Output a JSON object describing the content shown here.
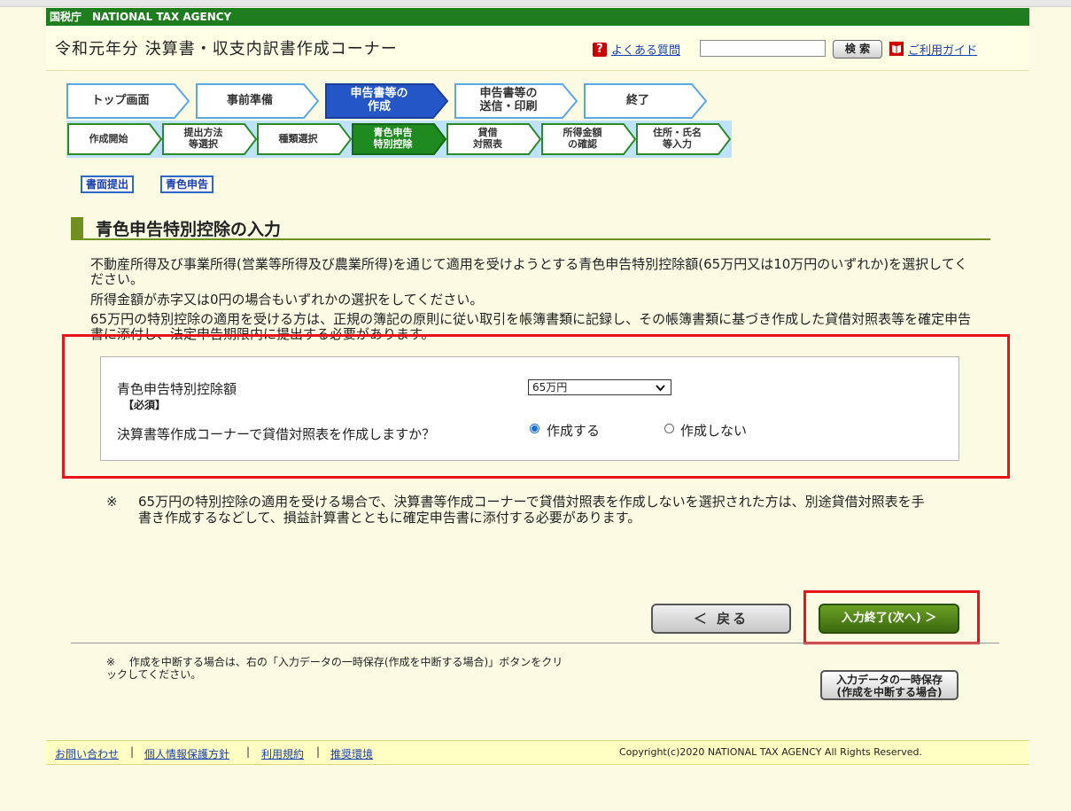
{
  "agency_label": "国税庁　NATIONAL TAX AGENCY",
  "header": {
    "title": "令和元年分 決算書・収支内訳書作成コーナー",
    "help_icon": "?",
    "faq_link": "よくある質問",
    "search_value": "",
    "search_button": "検 索",
    "guide_icon": "book-icon",
    "guide_link": "ご利用ガイド"
  },
  "main_steps": [
    {
      "label": "トップ画面",
      "active": false
    },
    {
      "label": "事前準備",
      "active": false
    },
    {
      "label": "申告書等の\n作成",
      "active": true
    },
    {
      "label": "申告書等の\n送信・印刷",
      "active": false
    },
    {
      "label": "終了",
      "active": false
    }
  ],
  "sub_steps": [
    {
      "label": "作成開始",
      "active": false
    },
    {
      "label": "提出方法\n等選択",
      "active": false
    },
    {
      "label": "種類選択",
      "active": false
    },
    {
      "label": "青色申告\n特別控除",
      "active": true
    },
    {
      "label": "貸借\n対照表",
      "active": false
    },
    {
      "label": "所得金額\nの確認",
      "active": false
    },
    {
      "label": "住所・氏名\n等入力",
      "active": false
    }
  ],
  "tags": [
    "書面提出",
    "青色申告"
  ],
  "section_title": "青色申告特別控除の入力",
  "instructions": [
    "不動産所得及び事業所得(営業等所得及び農業所得)を通じて適用を受けようとする青色申告特別控除額(65万円又は10万円のいずれか)を選択してください。",
    "所得金額が赤字又は0円の場合もいずれかの選択をしてください。",
    "65万円の特別控除の適用を受ける方は、正規の簿記の原則に従い取引を帳簿書類に記録し、その帳簿書類に基づき作成した貸借対照表等を確定申告書に添付し、法定申告期限内に提出する必要があります。"
  ],
  "form": {
    "deduction_label": "青色申告特別控除額",
    "required": "【必須】",
    "deduction_value": "65万円",
    "balance_sheet_question": "決算書等作成コーナーで貸借対照表を作成しますか？",
    "option_create": "作成する",
    "option_no_create": "作成しない",
    "selected": "create"
  },
  "note_mark": "※",
  "note_text": "65万円の特別控除の適用を受ける場合で、決算書等作成コーナーで貸借対照表を作成しないを選択された方は、別途貸借対照表を手書き作成するなどして、損益計算書とともに確定申告書に添付する必要があります。",
  "buttons": {
    "back": "＜ 戻る",
    "next": "入力終了(次へ) ＞",
    "save": "入力データの一時保存\n(作成を中断する場合)"
  },
  "save_note": "※　 作成を中断する場合は、右の「入力データの一時保存(作成を中断する場合)」ボタンをクリックしてください。",
  "footer": {
    "links": [
      "お問い合わせ",
      "個人情報保護方針",
      "利用規約",
      "推奨環境"
    ],
    "copyright": "Copyright(c)2020 NATIONAL TAX AGENCY All Rights Reserved."
  },
  "colors": {
    "agency_bar": "#1f7d1f",
    "active_step": "#2456c8",
    "active_substep": "#1f8a1f",
    "highlight": "#e8141c",
    "next_button": "#4f8a18"
  }
}
